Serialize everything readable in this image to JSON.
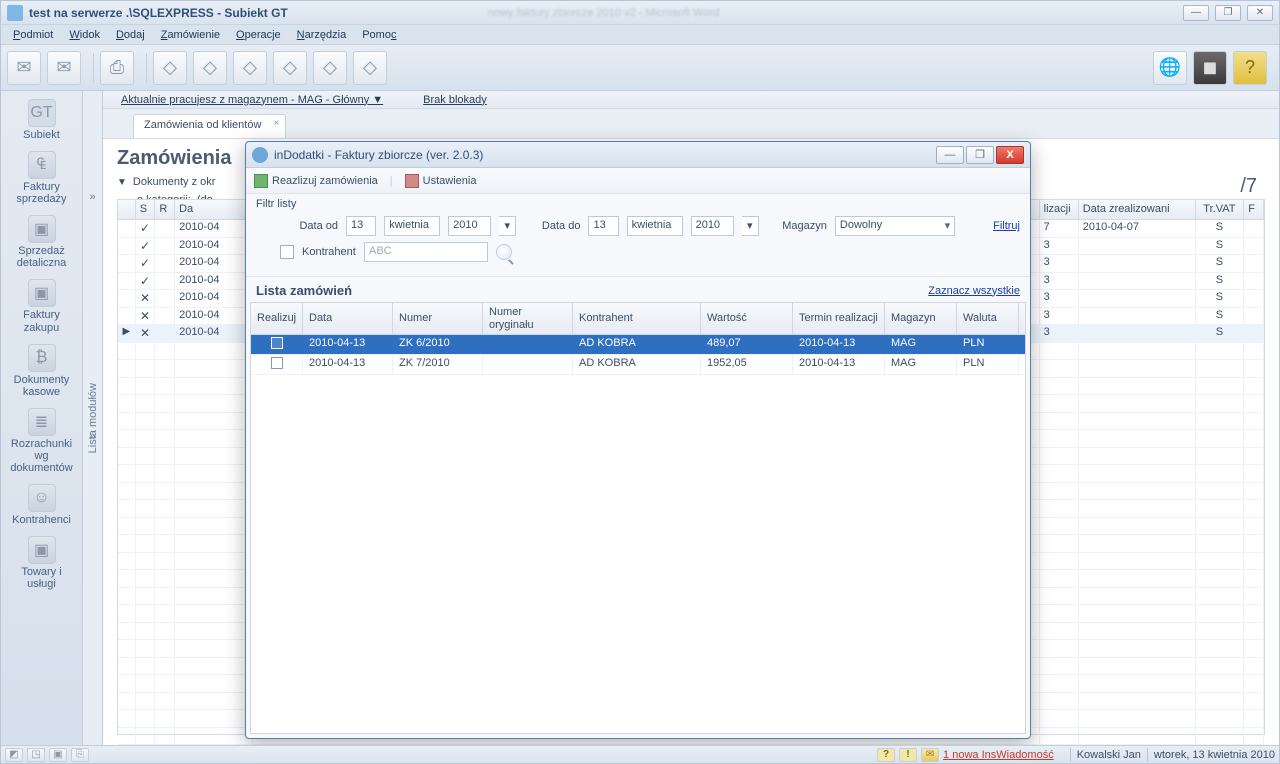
{
  "window": {
    "title": "test na serwerze .\\SQLEXPRESS - Subiekt GT",
    "blurred_extra": "nowy faktury zbiorcze 2010 v2 - Microsoft Word"
  },
  "menus": [
    "Podmiot",
    "Widok",
    "Dodaj",
    "Zamówienie",
    "Operacje",
    "Narzędzia",
    "Pomoc"
  ],
  "sidebar": {
    "logo": "Subiekt",
    "items": [
      "Faktury sprzedaży",
      "Sprzedaż detaliczna",
      "Faktury zakupu",
      "Dokumenty kasowe",
      "Rozrachunki wg dokumentów",
      "Kontrahenci",
      "Towary i usługi"
    ]
  },
  "mod_tab": "Lista modułów",
  "content_head": {
    "magazyn_label": "Aktualnie pracujesz z magazynem - MAG - Główny ▼",
    "brak_blokady": "Brak blokady"
  },
  "tab": {
    "label": "Zamówienia od klientów"
  },
  "page": {
    "title": "Zamówienia",
    "right_fraction": "/7",
    "filter_l1": "Dokumenty z okr",
    "filter_l2a": "o kategorii:",
    "filter_l2b": "(do"
  },
  "bg_grid": {
    "headers": [
      "",
      "S",
      "R",
      "Da",
      "",
      "lizacji",
      "Data zrealizowani",
      "Tr.VAT",
      "F"
    ],
    "rows": [
      {
        "ptr": "",
        "s": "✓",
        "r": "",
        "date": "2010-04",
        "liz": "7",
        "dzr": "2010-04-07",
        "tr": "S"
      },
      {
        "ptr": "",
        "s": "✓",
        "r": "",
        "date": "2010-04",
        "liz": "3",
        "dzr": "",
        "tr": "S"
      },
      {
        "ptr": "",
        "s": "✓",
        "r": "",
        "date": "2010-04",
        "liz": "3",
        "dzr": "",
        "tr": "S"
      },
      {
        "ptr": "",
        "s": "✓",
        "r": "",
        "date": "2010-04",
        "liz": "3",
        "dzr": "",
        "tr": "S"
      },
      {
        "ptr": "",
        "s": "✕",
        "r": "",
        "date": "2010-04",
        "liz": "3",
        "dzr": "",
        "tr": "S"
      },
      {
        "ptr": "",
        "s": "✕",
        "r": "",
        "date": "2010-04",
        "liz": "3",
        "dzr": "",
        "tr": "S"
      },
      {
        "ptr": "▶",
        "s": "✕",
        "r": "",
        "date": "2010-04",
        "liz": "3",
        "dzr": "",
        "tr": "S",
        "sel": true
      }
    ]
  },
  "dialog": {
    "title": "inDodatki - Faktury zbiorcze (ver. 2.0.3)",
    "toolbar": {
      "realize": "Reazlizuj zamówienia",
      "settings": "Ustawienia"
    },
    "filter": {
      "section": "Filtr listy",
      "data_od_lbl": "Data od",
      "data_do_lbl": "Data do",
      "day": "13",
      "month": "kwietnia",
      "year": "2010",
      "magazyn_lbl": "Magazyn",
      "magazyn_val": "Dowolny",
      "filtruj": "Filtruj",
      "kontrahent_lbl": "Kontrahent",
      "kontrahent_placeholder": "ABC"
    },
    "list": {
      "header": "Lista zamówień",
      "select_all": "Zaznacz wszystkie",
      "columns": [
        "Realizuj",
        "Data",
        "Numer",
        "Numer oryginału",
        "Kontrahent",
        "Wartość",
        "Termin realizacji",
        "Magazyn",
        "Waluta"
      ],
      "rows": [
        {
          "data": "2010-04-13",
          "numer": "ZK 6/2010",
          "orig": "",
          "kontr": "AD KOBRA",
          "wart": "489,07",
          "termin": "2010-04-13",
          "mag": "MAG",
          "wal": "PLN",
          "sel": true
        },
        {
          "data": "2010-04-13",
          "numer": "ZK 7/2010",
          "orig": "",
          "kontr": "AD KOBRA",
          "wart": "1952,05",
          "termin": "2010-04-13",
          "mag": "MAG",
          "wal": "PLN",
          "sel": false
        }
      ]
    }
  },
  "status": {
    "msg": "1 nowa InsWiadomość",
    "user": "Kowalski Jan",
    "date": "wtorek, 13 kwietnia 2010"
  }
}
